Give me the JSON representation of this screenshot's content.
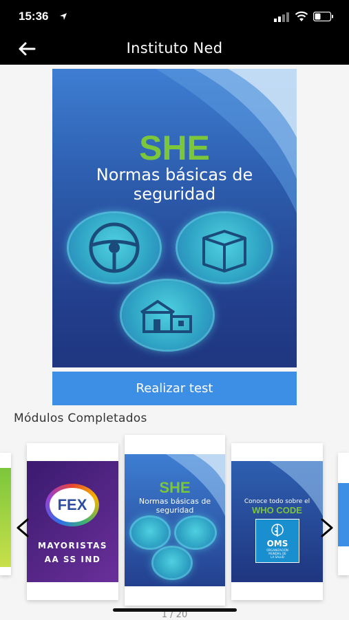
{
  "status": {
    "time": "15:36"
  },
  "nav": {
    "title": "Instituto Ned"
  },
  "hero": {
    "title": "SHE",
    "subtitle_line1": "Normas básicas de",
    "subtitle_line2": "seguridad"
  },
  "cta": {
    "label": "Realizar test"
  },
  "section": {
    "title": "Módulos Completados"
  },
  "carousel": {
    "cards": [
      {
        "brand": "FEX",
        "line1": "MAYORISTAS",
        "line2": "AA SS IND"
      },
      {
        "title": "SHE",
        "subtitle_line1": "Normas básicas de",
        "subtitle_line2": "seguridad"
      },
      {
        "line1": "Conoce todo sobre el",
        "line2": "WHO CODE",
        "logo": "OMS",
        "logo_sub1": "ORGANIZACIÓN",
        "logo_sub2": "MUNDIAL DE",
        "logo_sub3": "LA SALUD"
      }
    ],
    "pager": "1 / 20"
  },
  "colors": {
    "accent": "#3d8fe6",
    "she_green": "#7cc63c",
    "card_blue": "#23408e",
    "purple": "#4b1f7a"
  }
}
